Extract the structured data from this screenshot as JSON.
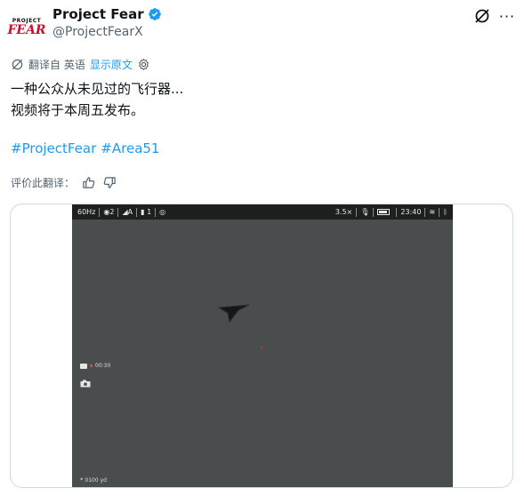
{
  "author": {
    "avatar_line1": "PROJECT",
    "avatar_line2": "FEAR",
    "name": "Project Fear",
    "handle": "@ProjectFearX"
  },
  "translation": {
    "label": "翻译自 英语",
    "show_original": "显示原文"
  },
  "tweet": {
    "line1": "一种公众从未见过的飞行器...",
    "line2": "视频将于本周五发布。",
    "hashtags": [
      "#ProjectFear",
      "#Area51"
    ]
  },
  "rate": {
    "label": "评价此翻译："
  },
  "video_hud": {
    "refresh": "60Hz",
    "mode": "2",
    "signal": "A",
    "battery_count": "1",
    "zoom": "3.5×",
    "time": "23:40",
    "rec_time": "00:30",
    "range": "0100 yd"
  },
  "colors": {
    "link": "#1d9bf0",
    "muted": "#536471",
    "border": "#cfd9de",
    "video_bg": "#4a4d4d"
  }
}
